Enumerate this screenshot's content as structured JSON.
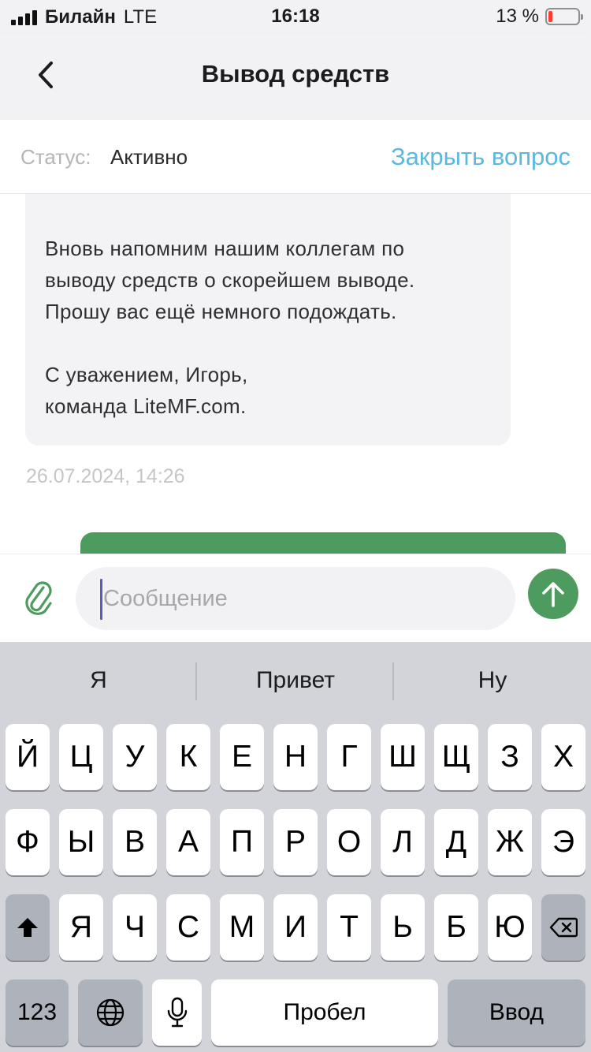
{
  "status_bar": {
    "carrier": "Билайн",
    "network": "LTE",
    "time": "16:18",
    "battery_percent": "13 %",
    "battery_level": 0.13
  },
  "nav": {
    "title": "Вывод средств",
    "back_icon": "chevron-left-icon"
  },
  "ticket": {
    "status_label": "Статус:",
    "status_value": "Активно",
    "close_label": "Закрыть вопрос"
  },
  "chat": {
    "message_lines": [
      "Вновь напомним нашим коллегам по",
      "выводу средств о скорейшем выводе.",
      "Прошу вас ещё немного подождать.",
      "С уважением, Игорь,",
      "команда LiteMF.com."
    ],
    "message_time": "26.07.2024, 14:26"
  },
  "composer": {
    "placeholder": "Сообщение",
    "attach_icon": "paperclip-icon",
    "send_icon": "arrow-up-icon"
  },
  "keyboard": {
    "suggestions": [
      "Я",
      "Привет",
      "Ну"
    ],
    "row1": [
      "Й",
      "Ц",
      "У",
      "К",
      "Е",
      "Н",
      "Г",
      "Ш",
      "Щ",
      "З",
      "Х"
    ],
    "row2": [
      "Ф",
      "Ы",
      "В",
      "А",
      "П",
      "Р",
      "О",
      "Л",
      "Д",
      "Ж",
      "Э"
    ],
    "row3": [
      "Я",
      "Ч",
      "С",
      "М",
      "И",
      "Т",
      "Ь",
      "Б",
      "Ю"
    ],
    "numbers_label": "123",
    "space_label": "Пробел",
    "return_label": "Ввод",
    "shift_icon": "shift-icon",
    "backspace_icon": "backspace-icon",
    "globe_icon": "globe-icon",
    "mic_icon": "microphone-icon"
  },
  "colors": {
    "accent_green": "#4e9b5f",
    "link_blue": "#5bb8de",
    "battery_red": "#ff3b30"
  }
}
